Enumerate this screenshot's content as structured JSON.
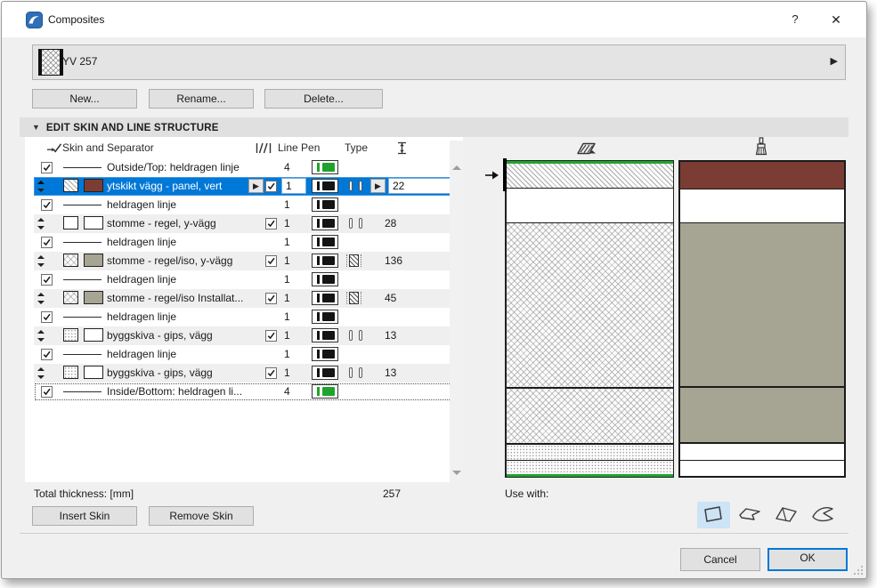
{
  "window": {
    "title": "Composites",
    "help": "?",
    "close": "✕"
  },
  "combo": {
    "value": "YV 257"
  },
  "actions": {
    "new": "New...",
    "rename": "Rename...",
    "delete": "Delete..."
  },
  "section": {
    "title": "EDIT SKIN AND LINE STRUCTURE"
  },
  "table": {
    "headers": {
      "name": "Skin and Separator",
      "line_pen": "Line Pen",
      "type": "Type"
    },
    "rows": [
      {
        "kind": "separator",
        "name": "Outside/Top: heldragen linje",
        "checked": true,
        "pen": "4",
        "pen_color": "#1fa32e"
      },
      {
        "kind": "skin",
        "name": "ytskikt vägg - panel, vert",
        "selected": true,
        "checked": true,
        "pen": "1",
        "pen_color": "#141414",
        "pattern": "diagonal",
        "surface": "#7a3c33",
        "type": "bars",
        "thickness": "22"
      },
      {
        "kind": "separator",
        "name": "heldragen linje",
        "checked": true,
        "pen": "1",
        "pen_color": "#141414"
      },
      {
        "kind": "skin",
        "name": "stomme - regel, y-vägg",
        "checked": true,
        "pen": "1",
        "pen_color": "#141414",
        "pattern": "empty",
        "surface": "#ffffff",
        "type": "bars",
        "thickness": "28"
      },
      {
        "kind": "separator",
        "name": "heldragen linje",
        "checked": true,
        "pen": "1",
        "pen_color": "#141414"
      },
      {
        "kind": "skin",
        "name": "stomme - regel/iso, y-vägg",
        "checked": true,
        "pen": "1",
        "pen_color": "#141414",
        "pattern": "insulation",
        "surface": "#a6a593",
        "type": "core",
        "thickness": "136"
      },
      {
        "kind": "separator",
        "name": "heldragen linje",
        "checked": true,
        "pen": "1",
        "pen_color": "#141414"
      },
      {
        "kind": "skin",
        "name": "stomme - regel/iso Installat...",
        "checked": true,
        "pen": "1",
        "pen_color": "#141414",
        "pattern": "insulation",
        "surface": "#a6a593",
        "type": "core",
        "thickness": "45"
      },
      {
        "kind": "separator",
        "name": "heldragen linje",
        "checked": true,
        "pen": "1",
        "pen_color": "#141414"
      },
      {
        "kind": "skin",
        "name": "byggskiva - gips, vägg",
        "checked": true,
        "pen": "1",
        "pen_color": "#141414",
        "pattern": "dots",
        "surface": "#ffffff",
        "type": "bars",
        "thickness": "13"
      },
      {
        "kind": "separator",
        "name": "heldragen linje",
        "checked": true,
        "pen": "1",
        "pen_color": "#141414"
      },
      {
        "kind": "skin",
        "name": "byggskiva - gips, vägg",
        "checked": true,
        "pen": "1",
        "pen_color": "#141414",
        "pattern": "dots",
        "surface": "#ffffff",
        "type": "bars",
        "thickness": "13"
      },
      {
        "kind": "separator",
        "name": "Inside/Bottom: heldragen li...",
        "focused": true,
        "checked": true,
        "pen": "4",
        "pen_color": "#1fa32e"
      }
    ]
  },
  "totals": {
    "label": "Total thickness: [mm]",
    "value": "257"
  },
  "skin_buttons": {
    "insert": "Insert Skin",
    "remove": "Remove Skin"
  },
  "preview": {
    "layers": [
      {
        "thickness": 22,
        "pattern": "diagonal",
        "surface": "#7a3c33",
        "selected": true,
        "divider": 0
      },
      {
        "thickness": 28,
        "pattern": "empty",
        "surface": "#ffffff",
        "divider": 1
      },
      {
        "thickness": 136,
        "pattern": "insulation",
        "surface": "#a6a593",
        "divider": 1
      },
      {
        "thickness": 45,
        "pattern": "insulation",
        "surface": "#a6a593",
        "divider": 2
      },
      {
        "thickness": 13,
        "pattern": "dots",
        "surface": "#ffffff",
        "divider": 2
      },
      {
        "thickness": 13,
        "pattern": "dots",
        "surface": "#ffffff",
        "divider": 1
      }
    ]
  },
  "use_with": {
    "label": "Use with:",
    "options": [
      {
        "name": "wall",
        "selected": true
      },
      {
        "name": "slab",
        "selected": false
      },
      {
        "name": "roof",
        "selected": false
      },
      {
        "name": "shell",
        "selected": false
      }
    ]
  },
  "dialog_buttons": {
    "cancel": "Cancel",
    "ok": "OK"
  },
  "colors": {
    "selection": "#0078d7",
    "pen_green": "#1fa32e",
    "highlight_bg": "#cde3f6"
  }
}
